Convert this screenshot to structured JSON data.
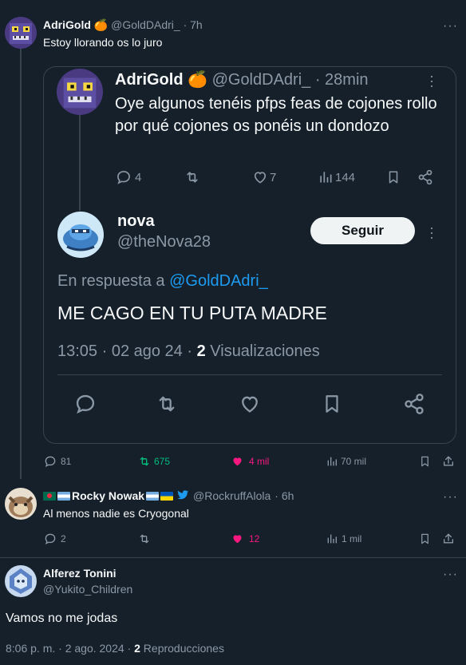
{
  "tweet1": {
    "name": "AdriGold",
    "emoji": "🍊",
    "handle": "@GoldDAdri_",
    "time": "· 7h",
    "text": "Estoy llorando os lo juro",
    "stats": {
      "replies": "81",
      "retweets": "675",
      "likes": "4 mil",
      "views": "70 mil"
    }
  },
  "quoted_original": {
    "name": "AdriGold",
    "emoji": "🍊",
    "handle": "@GoldDAdri_",
    "time": "· 28min",
    "text": "Oye algunos tenéis pfps feas de cojones rollo por qué cojones os ponéis un dondozo",
    "stats": {
      "replies": "4",
      "likes": "7",
      "views": "144"
    }
  },
  "quoted_reply": {
    "name": "nova",
    "handle": "@theNova28",
    "follow_label": "Seguir",
    "reply_prefix": "En respuesta a",
    "reply_to": "@GoldDAdri_",
    "text": "ME CAGO EN TU PUTA MADRE",
    "timestamp": "13:05 · 02 ago 24 ·",
    "views_count": "2",
    "views_label": "Visualizaciones"
  },
  "tweet2": {
    "name": "Rocky Nowak",
    "handle": "@RockruffAlola",
    "time": "· 6h",
    "text": "Al menos nadie es Cryogonal",
    "stats": {
      "replies": "2",
      "likes": "12",
      "views": "1 mil"
    }
  },
  "tweet3": {
    "name": "Alferez Tonini",
    "handle": "@Yukito_Children",
    "text": "Vamos no me jodas",
    "timestamp": "8:06 p. m. · 2 ago. 2024 ·",
    "views_count": "2",
    "views_label": "Reproducciones"
  },
  "colors": {
    "background": "#15202b",
    "accent": "#1d9bf0",
    "retweet": "#00ba7c",
    "like": "#f91880",
    "muted": "#8b98a5",
    "border": "#38444d"
  }
}
